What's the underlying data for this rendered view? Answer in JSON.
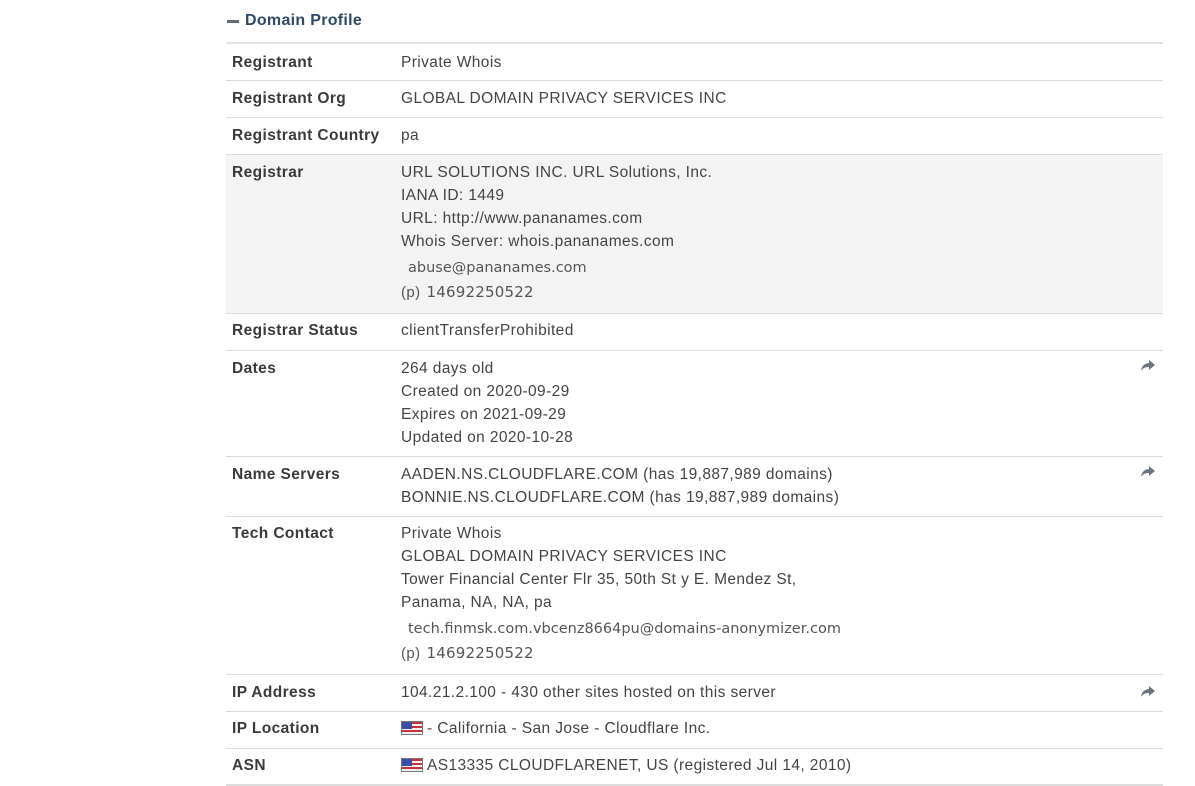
{
  "section": {
    "title": "Domain Profile"
  },
  "rows": {
    "registrant": {
      "label": "Registrant",
      "value": "Private Whois"
    },
    "registrant_org": {
      "label": "Registrant Org",
      "value": "GLOBAL DOMAIN PRIVACY SERVICES INC"
    },
    "registrant_country": {
      "label": "Registrant Country",
      "value": "pa"
    },
    "registrar": {
      "label": "Registrar",
      "lines": [
        "URL SOLUTIONS INC. URL Solutions, Inc.",
        "IANA ID: 1449",
        "URL: http://www.pananames.com",
        "Whois Server: whois.pananames.com"
      ],
      "email": "abuse@pananames.com",
      "phone_prefix": "(p)",
      "phone": "14692250522"
    },
    "registrar_status": {
      "label": "Registrar Status",
      "value": "clientTransferProhibited"
    },
    "dates": {
      "label": "Dates",
      "lines": [
        "264 days old",
        "Created on 2020-09-29",
        "Expires on 2021-09-29",
        "Updated on 2020-10-28"
      ],
      "icon": "share-arrow-icon"
    },
    "name_servers": {
      "label": "Name Servers",
      "lines": [
        "AADEN.NS.CLOUDFLARE.COM (has 19,887,989 domains)",
        "BONNIE.NS.CLOUDFLARE.COM (has 19,887,989 domains)"
      ],
      "icon": "share-arrow-icon"
    },
    "tech_contact": {
      "label": "Tech Contact",
      "lines": [
        "Private Whois",
        "GLOBAL DOMAIN PRIVACY SERVICES INC",
        "Tower Financial Center Flr 35, 50th St y E. Mendez St,",
        "Panama, NA, NA, pa"
      ],
      "email": "tech.finmsk.com.vbcenz8664pu@domains-anonymizer.com",
      "phone_prefix": "(p)",
      "phone": "14692250522"
    },
    "ip_address": {
      "label": "IP Address",
      "value": "104.21.2.100 - 430 other sites hosted on this server",
      "icon": "share-arrow-icon"
    },
    "ip_location": {
      "label": "IP Location",
      "value": "- California - San Jose - Cloudflare Inc.",
      "icon": "us-flag-icon"
    },
    "asn": {
      "label": "ASN",
      "value": "AS13335 CLOUDFLARENET, US (registered Jul 14, 2010)",
      "icon": "us-flag-icon"
    }
  },
  "colors": {
    "title": "#2f4a66",
    "alt_row_bg": "#f3f3f3",
    "border": "#dcdcdc"
  }
}
